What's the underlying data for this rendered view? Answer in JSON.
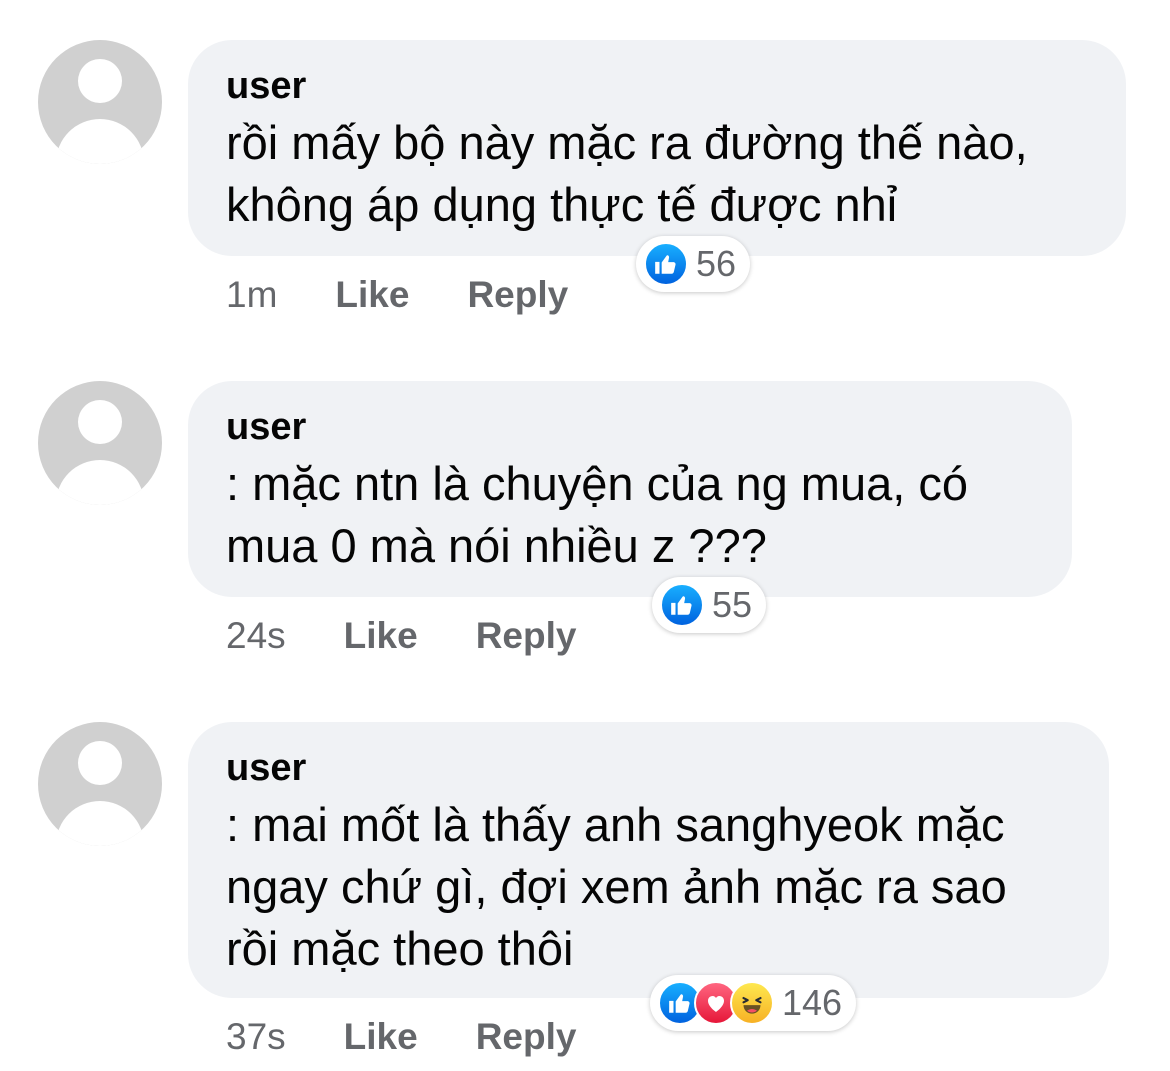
{
  "comments": [
    {
      "author": "user",
      "text": "rồi mấy bộ này mặc ra đường thế nào,\nkhông áp dụng thực tế được nhỉ",
      "reaction_count": "56",
      "reactions": [
        "like-icon"
      ],
      "time": "1m",
      "like_label": "Like",
      "reply_label": "Reply"
    },
    {
      "author": "user",
      "text": ": mặc ntn là chuyện của ng mua, có\nmua 0 mà nói nhiều z ???",
      "reaction_count": "55",
      "reactions": [
        "like-icon"
      ],
      "time": "24s",
      "like_label": "Like",
      "reply_label": "Reply"
    },
    {
      "author": "user",
      "text": ": mai mốt là thấy anh sanghyeok mặc\nngay chứ gì, đợi xem ảnh mặc ra sao\nrồi mặc theo thôi",
      "reaction_count": "146",
      "reactions": [
        "like-icon",
        "love-icon",
        "haha-icon"
      ],
      "time": "37s",
      "like_label": "Like",
      "reply_label": "Reply"
    }
  ],
  "colors": {
    "bubble": "#f0f2f5",
    "secondary_text": "#65676b",
    "like_blue": "#1877f2",
    "love_red": "#f33e58",
    "haha_yellow": "#f7b125"
  }
}
